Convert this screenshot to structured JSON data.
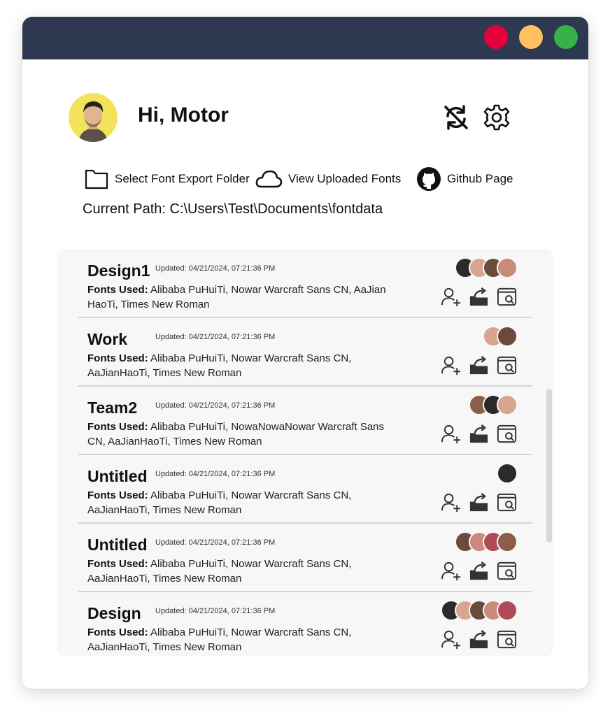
{
  "window": {
    "controls": [
      {
        "name": "close",
        "color": "#e4003a"
      },
      {
        "name": "minimize",
        "color": "#ffc15e"
      },
      {
        "name": "maximize",
        "color": "#35b24a"
      }
    ]
  },
  "header": {
    "greeting": "Hi, Motor",
    "icons": [
      "sync-off-icon",
      "settings-gear-icon"
    ]
  },
  "links": [
    {
      "label": "Select Font Export Folder",
      "icon": "folder-icon"
    },
    {
      "label": "View Uploaded Fonts",
      "icon": "cloud-icon"
    },
    {
      "label": "Github Page",
      "icon": "github-icon"
    }
  ],
  "current_path": "Current Path: C:\\Users\\Test\\Documents\\fontdata",
  "projects": [
    {
      "title": "Design1",
      "updated": "Updated: 04/21/2024, 07:21:36 PM",
      "fonts_label": "Fonts Used:",
      "fonts": "Alibaba PuHuiTi, Nowar Warcraft Sans CN, AaJian HaoTi, Times New Roman",
      "members": 4
    },
    {
      "title": "Work",
      "updated": "Updated: 04/21/2024, 07:21:36 PM",
      "fonts_label": "Fonts Used:",
      "fonts": "Alibaba PuHuiTi, Nowar Warcraft Sans CN, AaJianHaoTi, Times New Roman",
      "members": 2
    },
    {
      "title": "Team2",
      "updated": "Updated: 04/21/2024, 07:21:36 PM",
      "fonts_label": "Fonts Used:",
      "fonts": "Alibaba PuHuiTi, NowaNowaNowar Warcraft Sans CN, AaJianHaoTi, Times New Roman",
      "members": 3
    },
    {
      "title": "Untitled",
      "updated": "Updated: 04/21/2024, 07:21:36 PM",
      "fonts_label": "Fonts Used:",
      "fonts": "Alibaba PuHuiTi, Nowar Warcraft Sans CN, AaJianHaoTi, Times New Roman",
      "members": 1
    },
    {
      "title": "Untitled",
      "updated": "Updated: 04/21/2024, 07:21:36 PM",
      "fonts_label": "Fonts Used:",
      "fonts": "Alibaba PuHuiTi, Nowar Warcraft Sans CN, AaJianHaoTi, Times New Roman",
      "members": 4
    },
    {
      "title": "Design",
      "updated": "Updated: 04/21/2024, 07:21:36 PM",
      "fonts_label": "Fonts Used:",
      "fonts": "Alibaba PuHuiTi, Nowar Warcraft Sans CN, AaJianHaoTi, Times New Roman",
      "members": 5
    }
  ],
  "row_actions": [
    "add-member-icon",
    "export-folder-icon",
    "preview-window-icon"
  ],
  "colors": {
    "titlebar": "#2e3850",
    "panel": "#f7f7f7",
    "avatar_bg": "#f2e35a",
    "member_avatars": [
      "#c98a7a",
      "#6a4a3c",
      "#d9a58f",
      "#2a2a2a",
      "#8c5e4a",
      "#b04a5a"
    ]
  }
}
